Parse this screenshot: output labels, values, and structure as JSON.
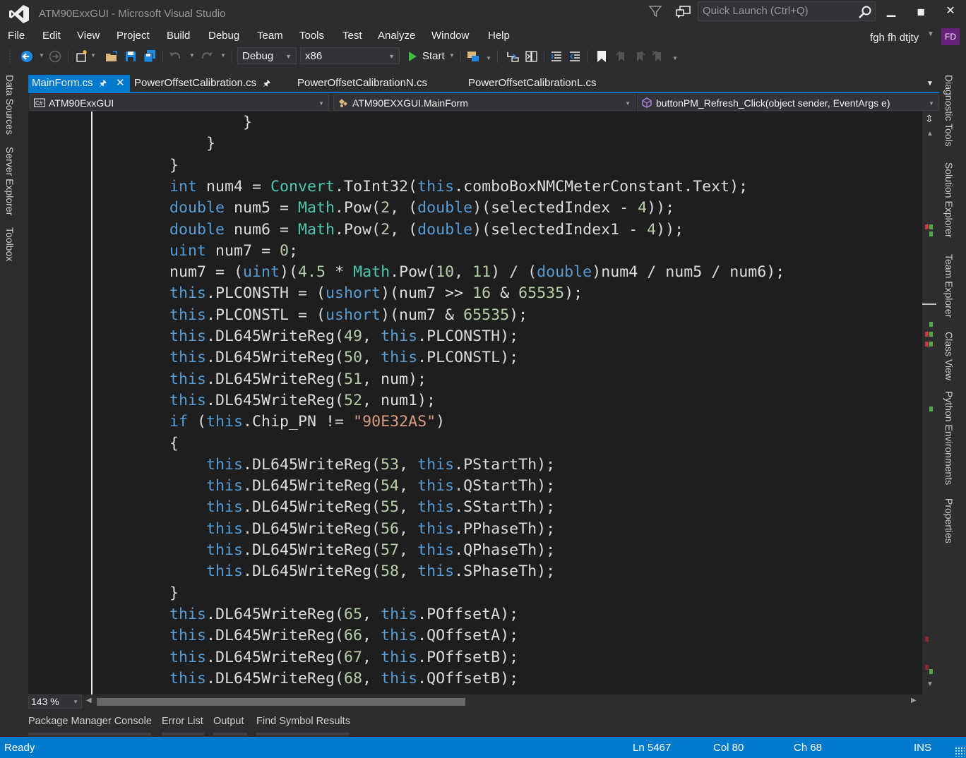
{
  "window": {
    "title": "ATM90ExxGUI - Microsoft Visual Studio",
    "quick_launch_placeholder": "Quick Launch (Ctrl+Q)",
    "minimize": "🗕",
    "maximize": "■",
    "close": "✕"
  },
  "menu": [
    "File",
    "Edit",
    "View",
    "Project",
    "Build",
    "Debug",
    "Team",
    "Tools",
    "Test",
    "Analyze",
    "Window",
    "Help"
  ],
  "user": {
    "name": "fgh fh dtjty",
    "initials": "FD"
  },
  "toolbar": {
    "config": "Debug",
    "platform": "x86",
    "start_label": "Start"
  },
  "left_tool_tabs": [
    "Data Sources",
    "Server Explorer",
    "Toolbox"
  ],
  "right_tool_tabs": [
    "Diagnostic Tools",
    "Solution Explorer",
    "Team Explorer",
    "Class View",
    "Python Environments",
    "Properties"
  ],
  "doc_tabs": [
    {
      "label": "MainForm.cs",
      "active": true
    },
    {
      "label": "PowerOffsetCalibration.cs",
      "active": false
    },
    {
      "label": "PowerOffsetCalibrationN.cs",
      "active": false
    },
    {
      "label": "PowerOffsetCalibrationL.cs",
      "active": false
    }
  ],
  "nav": {
    "project": "ATM90ExxGUI",
    "class": "ATM90EXXGUI.MainForm",
    "member": "buttonPM_Refresh_Click(object sender, EventArgs e)"
  },
  "code_lines": [
    [
      [
        "p",
        "                }"
      ]
    ],
    [
      [
        "p",
        "            }"
      ]
    ],
    [
      [
        "p",
        "        }"
      ]
    ],
    [
      [
        "k",
        "        int"
      ],
      [
        "p",
        " num4 = "
      ],
      [
        "t",
        "Convert"
      ],
      [
        "p",
        ".ToInt32("
      ],
      [
        "k",
        "this"
      ],
      [
        "p",
        ".comboBoxNMCMeterConstant.Text);"
      ]
    ],
    [
      [
        "k",
        "        double"
      ],
      [
        "p",
        " num5 = "
      ],
      [
        "t",
        "Math"
      ],
      [
        "p",
        ".Pow("
      ],
      [
        "n",
        "2"
      ],
      [
        "p",
        ", ("
      ],
      [
        "k",
        "double"
      ],
      [
        "p",
        ")(selectedIndex - "
      ],
      [
        "n",
        "4"
      ],
      [
        "p",
        "));"
      ]
    ],
    [
      [
        "k",
        "        double"
      ],
      [
        "p",
        " num6 = "
      ],
      [
        "t",
        "Math"
      ],
      [
        "p",
        ".Pow("
      ],
      [
        "n",
        "2"
      ],
      [
        "p",
        ", ("
      ],
      [
        "k",
        "double"
      ],
      [
        "p",
        ")(selectedIndex1 - "
      ],
      [
        "n",
        "4"
      ],
      [
        "p",
        "));"
      ]
    ],
    [
      [
        "k",
        "        uint"
      ],
      [
        "p",
        " num7 = "
      ],
      [
        "n",
        "0"
      ],
      [
        "p",
        ";"
      ]
    ],
    [
      [
        "p",
        "        num7 = ("
      ],
      [
        "k",
        "uint"
      ],
      [
        "p",
        ")("
      ],
      [
        "n",
        "4.5"
      ],
      [
        "p",
        " * "
      ],
      [
        "t",
        "Math"
      ],
      [
        "p",
        ".Pow("
      ],
      [
        "n",
        "10"
      ],
      [
        "p",
        ", "
      ],
      [
        "n",
        "11"
      ],
      [
        "p",
        ") / ("
      ],
      [
        "k",
        "double"
      ],
      [
        "p",
        ")num4 / num5 / num6);"
      ]
    ],
    [
      [
        "k",
        "        this"
      ],
      [
        "p",
        ".PLCONSTH = ("
      ],
      [
        "k",
        "ushort"
      ],
      [
        "p",
        ")(num7 >> "
      ],
      [
        "n",
        "16"
      ],
      [
        "p",
        " & "
      ],
      [
        "n",
        "65535"
      ],
      [
        "p",
        ");"
      ]
    ],
    [
      [
        "k",
        "        this"
      ],
      [
        "p",
        ".PLCONSTL = ("
      ],
      [
        "k",
        "ushort"
      ],
      [
        "p",
        ")(num7 & "
      ],
      [
        "n",
        "65535"
      ],
      [
        "p",
        ");"
      ]
    ],
    [
      [
        "k",
        "        this"
      ],
      [
        "p",
        ".DL645WriteReg("
      ],
      [
        "n",
        "49"
      ],
      [
        "p",
        ", "
      ],
      [
        "k",
        "this"
      ],
      [
        "p",
        ".PLCONSTH);"
      ]
    ],
    [
      [
        "k",
        "        this"
      ],
      [
        "p",
        ".DL645WriteReg("
      ],
      [
        "n",
        "50"
      ],
      [
        "p",
        ", "
      ],
      [
        "k",
        "this"
      ],
      [
        "p",
        ".PLCONSTL);"
      ]
    ],
    [
      [
        "k",
        "        this"
      ],
      [
        "p",
        ".DL645WriteReg("
      ],
      [
        "n",
        "51"
      ],
      [
        "p",
        ", num);"
      ]
    ],
    [
      [
        "k",
        "        this"
      ],
      [
        "p",
        ".DL645WriteReg("
      ],
      [
        "n",
        "52"
      ],
      [
        "p",
        ", num1);"
      ]
    ],
    [
      [
        "k",
        "        if"
      ],
      [
        "p",
        " ("
      ],
      [
        "k",
        "this"
      ],
      [
        "p",
        ".Chip_PN != "
      ],
      [
        "s",
        "\"90E32AS\""
      ],
      [
        "p",
        ")"
      ]
    ],
    [
      [
        "p",
        "        {"
      ]
    ],
    [
      [
        "k",
        "            this"
      ],
      [
        "p",
        ".DL645WriteReg("
      ],
      [
        "n",
        "53"
      ],
      [
        "p",
        ", "
      ],
      [
        "k",
        "this"
      ],
      [
        "p",
        ".PStartTh);"
      ]
    ],
    [
      [
        "k",
        "            this"
      ],
      [
        "p",
        ".DL645WriteReg("
      ],
      [
        "n",
        "54"
      ],
      [
        "p",
        ", "
      ],
      [
        "k",
        "this"
      ],
      [
        "p",
        ".QStartTh);"
      ]
    ],
    [
      [
        "k",
        "            this"
      ],
      [
        "p",
        ".DL645WriteReg("
      ],
      [
        "n",
        "55"
      ],
      [
        "p",
        ", "
      ],
      [
        "k",
        "this"
      ],
      [
        "p",
        ".SStartTh);"
      ]
    ],
    [
      [
        "k",
        "            this"
      ],
      [
        "p",
        ".DL645WriteReg("
      ],
      [
        "n",
        "56"
      ],
      [
        "p",
        ", "
      ],
      [
        "k",
        "this"
      ],
      [
        "p",
        ".PPhaseTh);"
      ]
    ],
    [
      [
        "k",
        "            this"
      ],
      [
        "p",
        ".DL645WriteReg("
      ],
      [
        "n",
        "57"
      ],
      [
        "p",
        ", "
      ],
      [
        "k",
        "this"
      ],
      [
        "p",
        ".QPhaseTh);"
      ]
    ],
    [
      [
        "k",
        "            this"
      ],
      [
        "p",
        ".DL645WriteReg("
      ],
      [
        "n",
        "58"
      ],
      [
        "p",
        ", "
      ],
      [
        "k",
        "this"
      ],
      [
        "p",
        ".SPhaseTh);"
      ]
    ],
    [
      [
        "p",
        "        }"
      ]
    ],
    [
      [
        "k",
        "        this"
      ],
      [
        "p",
        ".DL645WriteReg("
      ],
      [
        "n",
        "65"
      ],
      [
        "p",
        ", "
      ],
      [
        "k",
        "this"
      ],
      [
        "p",
        ".POffsetA);"
      ]
    ],
    [
      [
        "k",
        "        this"
      ],
      [
        "p",
        ".DL645WriteReg("
      ],
      [
        "n",
        "66"
      ],
      [
        "p",
        ", "
      ],
      [
        "k",
        "this"
      ],
      [
        "p",
        ".QOffsetA);"
      ]
    ],
    [
      [
        "k",
        "        this"
      ],
      [
        "p",
        ".DL645WriteReg("
      ],
      [
        "n",
        "67"
      ],
      [
        "p",
        ", "
      ],
      [
        "k",
        "this"
      ],
      [
        "p",
        ".POffsetB);"
      ]
    ],
    [
      [
        "k",
        "        this"
      ],
      [
        "p",
        ".DL645WriteReg("
      ],
      [
        "n",
        "68"
      ],
      [
        "p",
        ", "
      ],
      [
        "k",
        "this"
      ],
      [
        "p",
        ".QOffsetB);"
      ]
    ]
  ],
  "editor": {
    "zoom": "143 %"
  },
  "bottom_tabs": [
    "Package Manager Console",
    "Error List",
    "Output",
    "Find Symbol Results"
  ],
  "status": {
    "state": "Ready",
    "line": "Ln 5467",
    "col": "Col 80",
    "ch": "Ch 68",
    "mode": "INS"
  },
  "colors": {
    "accent": "#007acc",
    "keyword": "#569cd6",
    "type": "#4ec9b0",
    "number": "#b5cea8",
    "string": "#d69d85",
    "code_text": "#dcdcdc",
    "editor_bg": "#1e1e1e"
  }
}
